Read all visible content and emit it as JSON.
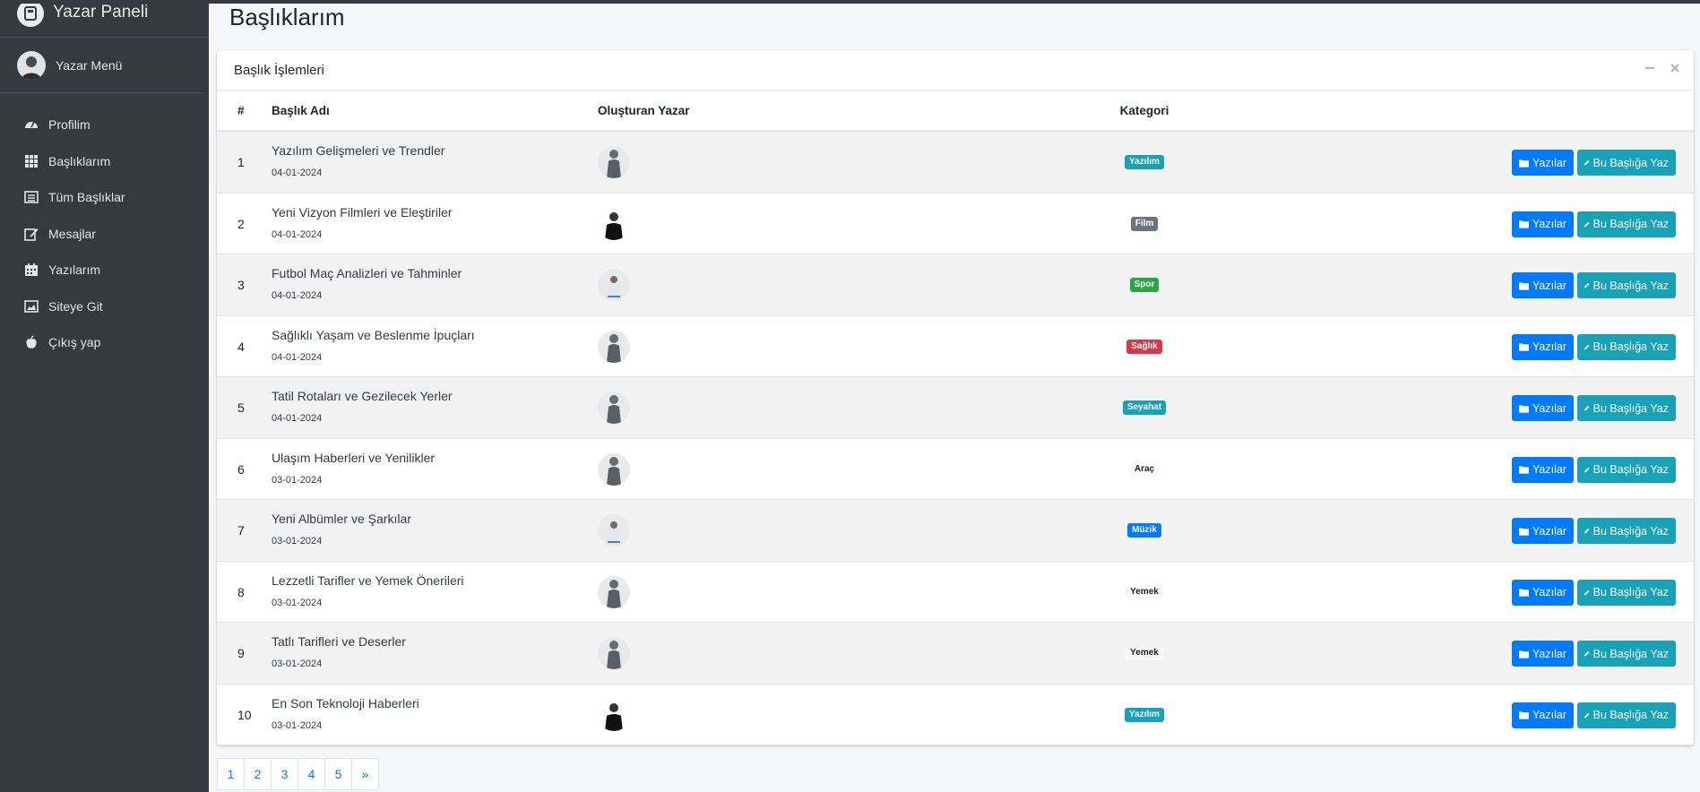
{
  "sidebar": {
    "brand": "Yazar Paneli",
    "user_menu": "Yazar Menü",
    "items": [
      {
        "label": "Profilim",
        "icon": "dashboard-icon"
      },
      {
        "label": "Başlıklarım",
        "icon": "grid-icon"
      },
      {
        "label": "Tüm Başlıklar",
        "icon": "list-icon"
      },
      {
        "label": "Mesajlar",
        "icon": "edit-icon"
      },
      {
        "label": "Yazılarım",
        "icon": "calendar-icon"
      },
      {
        "label": "Siteye Git",
        "icon": "image-icon"
      },
      {
        "label": "Çıkış yap",
        "icon": "apple-icon"
      }
    ]
  },
  "page": {
    "title": "Başlıklarım"
  },
  "card": {
    "title": "Başlık İşlemleri"
  },
  "table": {
    "headers": {
      "num": "#",
      "name": "Başlık Adı",
      "author": "Oluşturan Yazar",
      "category": "Kategori"
    },
    "button_posts": "Yazılar",
    "button_write": "Bu Başlığa Yaz",
    "rows": [
      {
        "num": "1",
        "name": "Yazılım Gelişmeleri ve Trendler",
        "date": "04-01-2024",
        "category": "Yazılım",
        "badge_color": "#17a2b8",
        "badge_text": "#ffffff"
      },
      {
        "num": "2",
        "name": "Yeni Vizyon Filmleri ve Eleştiriler",
        "date": "04-01-2024",
        "category": "Film",
        "badge_color": "#6c757d",
        "badge_text": "#ffffff"
      },
      {
        "num": "3",
        "name": "Futbol Maç Analizleri ve Tahminler",
        "date": "04-01-2024",
        "category": "Spor",
        "badge_color": "#28a745",
        "badge_text": "#ffffff"
      },
      {
        "num": "4",
        "name": "Sağlıklı Yaşam ve Beslenme İpuçları",
        "date": "04-01-2024",
        "category": "Sağlık",
        "badge_color": "#dc3545",
        "badge_text": "#ffffff"
      },
      {
        "num": "5",
        "name": "Tatil Rotaları ve Gezilecek Yerler",
        "date": "04-01-2024",
        "category": "Seyahat",
        "badge_color": "#17a2b8",
        "badge_text": "#ffffff"
      },
      {
        "num": "6",
        "name": "Ulaşım Haberleri ve Yenilikler",
        "date": "03-01-2024",
        "category": "Araç",
        "badge_color": "#f8f9fa",
        "badge_text": "#212529"
      },
      {
        "num": "7",
        "name": "Yeni Albümler ve Şarkılar",
        "date": "03-01-2024",
        "category": "Müzik",
        "badge_color": "#007bff",
        "badge_text": "#ffffff"
      },
      {
        "num": "8",
        "name": "Lezzetli Tarifler ve Yemek Önerileri",
        "date": "03-01-2024",
        "category": "Yemek",
        "badge_color": "#f8f9fa",
        "badge_text": "#212529"
      },
      {
        "num": "9",
        "name": "Tatlı Tarifleri ve Deserler",
        "date": "03-01-2024",
        "category": "Yemek",
        "badge_color": "#f8f9fa",
        "badge_text": "#212529"
      },
      {
        "num": "10",
        "name": "En Son Teknoloji Haberleri",
        "date": "03-01-2024",
        "category": "Yazılım",
        "badge_color": "#17a2b8",
        "badge_text": "#ffffff"
      }
    ]
  },
  "pagination": [
    "1",
    "2",
    "3",
    "4",
    "5",
    "»"
  ],
  "colors": {
    "sidebar": "#343a40",
    "primary": "#007bff",
    "info": "#17a2b8"
  }
}
